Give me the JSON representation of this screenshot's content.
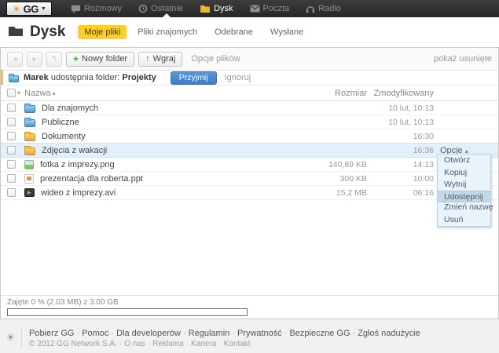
{
  "topbar": {
    "logo_text": "GG",
    "nav": [
      {
        "label": "Rozmowy",
        "icon": "chat-icon"
      },
      {
        "label": "Ostatnie",
        "icon": "clock-icon"
      },
      {
        "label": "Dysk",
        "icon": "folder-icon",
        "active": true
      },
      {
        "label": "Poczta",
        "icon": "mail-icon"
      },
      {
        "label": "Radio",
        "icon": "headphones-icon"
      }
    ]
  },
  "header": {
    "title": "Dysk",
    "tabs": [
      {
        "label": "Moje pliki",
        "active": true
      },
      {
        "label": "Pliki znajomych",
        "active": false
      },
      {
        "label": "Odebrane",
        "active": false
      },
      {
        "label": "Wysłane",
        "active": false
      }
    ]
  },
  "toolbar": {
    "back": "◂",
    "forward": "▸",
    "up_level": "↰",
    "new_folder_plus": "+",
    "new_folder_label": "Nowy folder",
    "upload_arrow": "↑",
    "upload_label": "Wgraj",
    "file_options_label": "Opcje plików",
    "show_deleted_label": "pokaż usunięte"
  },
  "notification": {
    "user": "Marek",
    "text": "udostępnia folder:",
    "folder": "Projekty",
    "accept_label": "Przyjmij",
    "ignore_label": "Ignoruj"
  },
  "table": {
    "columns": {
      "name": "Nazwa",
      "size": "Rozmiar",
      "modified": "Zmodyfikowany"
    },
    "sort_indicator": "▴",
    "rows": [
      {
        "name": "Dla znajomych",
        "icon": "shared-folder",
        "size": "",
        "modified": "10 lut, 10:13"
      },
      {
        "name": "Publiczne",
        "icon": "shared-folder",
        "size": "",
        "modified": "10 lut, 10:13"
      },
      {
        "name": "Dokumenty",
        "icon": "folder",
        "size": "",
        "modified": "16:30"
      },
      {
        "name": "Zdjęcia z wakacji",
        "icon": "folder",
        "size": "",
        "modified": "16:36",
        "selected": true,
        "options_label": "Opcje"
      },
      {
        "name": "fotka z imprezy.png",
        "icon": "image-file",
        "size": "140,89 KB",
        "modified": "14:13"
      },
      {
        "name": "prezentacja dla roberta.ppt",
        "icon": "presentation-file",
        "size": "300 KB",
        "modified": "10:00"
      },
      {
        "name": "wideo z imprezy.avi",
        "icon": "video-file",
        "size": "15,2 MB",
        "modified": "06:16"
      }
    ]
  },
  "context_menu": {
    "items": [
      {
        "label": "Otwórz",
        "highlighted": false
      },
      {
        "label": "Kopiuj",
        "highlighted": false
      },
      {
        "label": "Wytnij",
        "highlighted": false
      },
      {
        "label": "Udostępnij",
        "highlighted": true
      },
      {
        "label": "Zmień nazwę",
        "highlighted": false
      },
      {
        "label": "Usuń",
        "highlighted": false
      }
    ]
  },
  "storage": {
    "label": "Zajęte 0 % (2.03 MB) z 3.00 GB",
    "percent_used": 0
  },
  "footer": {
    "links_primary": [
      "Pobierz GG",
      "Pomoc",
      "Dla developerów",
      "Regulamin",
      "Prywatność",
      "Bezpieczne GG",
      "Zgłoś nadużycie"
    ],
    "copyright": "© 2012 GG Network S.A.",
    "links_secondary": [
      "O nas",
      "Reklama",
      "Kariera",
      "Kontakt"
    ]
  },
  "colors": {
    "accent_yellow": "#fbce2c",
    "accent_blue": "#4a86d8",
    "topbar_bg": "#2e2e2e",
    "selected_row": "#e3f0fb"
  }
}
